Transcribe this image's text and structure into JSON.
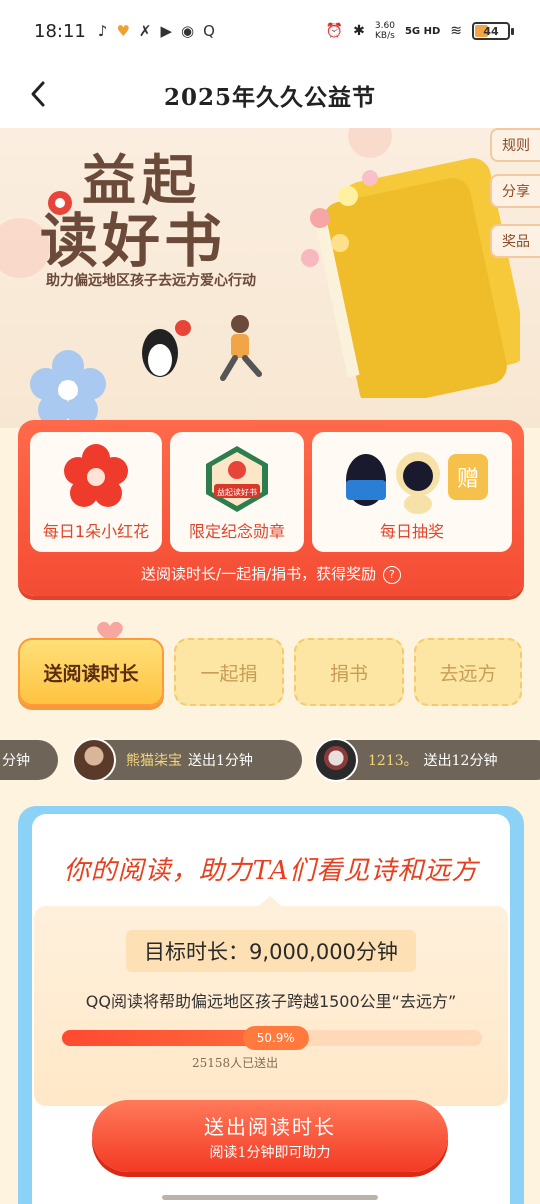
{
  "status_bar": {
    "time": "18:11",
    "net_speed_value": "3.60",
    "net_speed_unit": "KB/s",
    "signal": "5G HD",
    "battery": "44",
    "battery_level": 0.44
  },
  "nav": {
    "title": "2025年久久公益节"
  },
  "hero": {
    "title_line1": "益起",
    "title_line2": "读好书",
    "subtitle": "助力偏远地区孩子去远方爱心行动",
    "side_buttons": [
      "规则",
      "分享",
      "奖品"
    ]
  },
  "rewards": {
    "items": [
      {
        "label": "每日1朵小红花"
      },
      {
        "label": "限定纪念勋章",
        "badge_text": "益起读好书"
      },
      {
        "label": "每日抽奖",
        "bonus_text": "赠"
      }
    ],
    "hint": "送阅读时长/一起捐/捐书，获得奖励"
  },
  "tabs": [
    {
      "label": "送阅读时长",
      "active": true
    },
    {
      "label": "一起捐",
      "active": false
    },
    {
      "label": "捐书",
      "active": false
    },
    {
      "label": "去远方",
      "active": false
    }
  ],
  "ticker": [
    {
      "name": "",
      "action": "分钟"
    },
    {
      "name": "熊猫柒宝",
      "action": "送出1分钟"
    },
    {
      "name": "1213。",
      "action": "送出12分钟"
    }
  ],
  "panel": {
    "slogan": "你的阅读，助力TA们看见诗和远方",
    "goal_title": "目标时长：9,000,000分钟",
    "goal_desc": "QQ阅读将帮助偏远地区孩子跨越1500公里“去远方”",
    "progress_label": "50.9%",
    "progress_value": 0.509,
    "participants": "25158人已送出",
    "cta_title": "送出阅读时长",
    "cta_sub": "阅读1分钟即可助力"
  },
  "colors": {
    "accent_red": "#f44c34",
    "tab_yellow": "#ffc340",
    "panel_blue": "#8cd2f7",
    "page_bg": "#fdf3de"
  }
}
